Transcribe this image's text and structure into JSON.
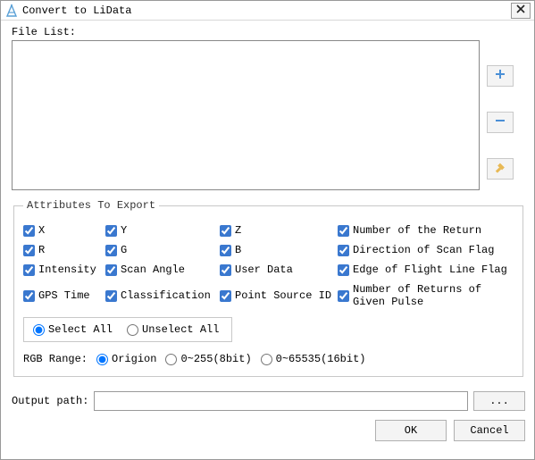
{
  "window": {
    "title": "Convert to LiData"
  },
  "file_list": {
    "label": "File List:"
  },
  "side": {
    "add_tip": "+",
    "remove_tip": "−",
    "clear_tip": "✏"
  },
  "attrs": {
    "legend": "Attributes To Export",
    "items": [
      {
        "label": "X"
      },
      {
        "label": "Y"
      },
      {
        "label": "Z"
      },
      {
        "label": "Number of the Return"
      },
      {
        "label": "R"
      },
      {
        "label": "G"
      },
      {
        "label": "B"
      },
      {
        "label": "Direction of Scan Flag"
      },
      {
        "label": "Intensity"
      },
      {
        "label": "Scan Angle"
      },
      {
        "label": "User Data"
      },
      {
        "label": "Edge of Flight Line Flag"
      },
      {
        "label": "GPS Time"
      },
      {
        "label": "Classification"
      },
      {
        "label": "Point Source ID"
      },
      {
        "label": "Number of Returns of Given Pulse"
      }
    ],
    "select_all": "Select All",
    "unselect_all": "Unselect All",
    "select_mode": "select_all"
  },
  "rgb": {
    "label": "RGB Range:",
    "options": [
      {
        "label": "Origion"
      },
      {
        "label": "0~255(8bit)"
      },
      {
        "label": "0~65535(16bit)"
      }
    ],
    "selected": "Origion"
  },
  "output": {
    "label": "Output path:",
    "value": "",
    "browse": "..."
  },
  "buttons": {
    "ok": "OK",
    "cancel": "Cancel"
  }
}
